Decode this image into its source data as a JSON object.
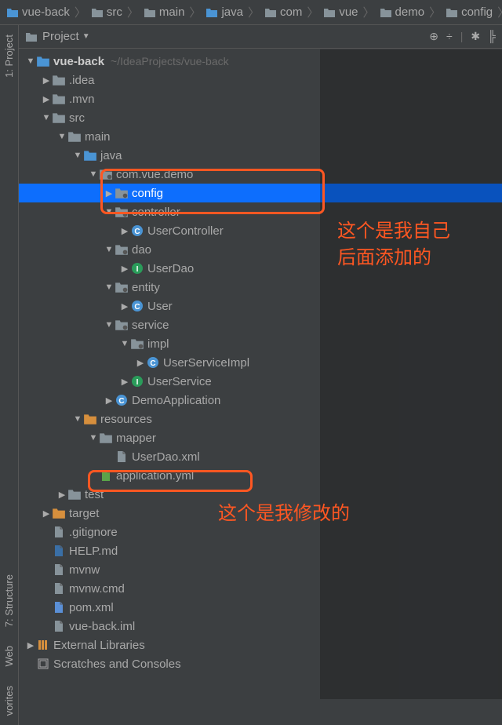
{
  "breadcrumbs": [
    {
      "icon": "folder-blue",
      "label": "vue-back"
    },
    {
      "icon": "folder",
      "label": "src"
    },
    {
      "icon": "folder",
      "label": "main"
    },
    {
      "icon": "folder-blue",
      "label": "java"
    },
    {
      "icon": "folder",
      "label": "com"
    },
    {
      "icon": "folder",
      "label": "vue"
    },
    {
      "icon": "folder",
      "label": "demo"
    },
    {
      "icon": "folder",
      "label": "config"
    }
  ],
  "panel": {
    "title": "Project"
  },
  "sidebarTabs": {
    "project": "1: Project",
    "structure": "7: Structure",
    "web": "Web",
    "favorites": "vorites"
  },
  "tree": {
    "root": {
      "label": "vue-back",
      "path": "~/IdeaProjects/vue-back"
    },
    "nodes": {
      "idea": ".idea",
      "mvn": ".mvn",
      "src": "src",
      "main": "main",
      "java": "java",
      "pkg": "com.vue.demo",
      "config": "config",
      "controller": "controller",
      "userController": "UserController",
      "dao": "dao",
      "userDao": "UserDao",
      "entity": "entity",
      "user": "User",
      "service": "service",
      "impl": "impl",
      "userServiceImpl": "UserServiceImpl",
      "userService": "UserService",
      "demoApp": "DemoApplication",
      "resources": "resources",
      "mapper": "mapper",
      "userDaoXml": "UserDao.xml",
      "appYml": "application.yml",
      "test": "test",
      "target": "target",
      "gitignore": ".gitignore",
      "help": "HELP.md",
      "mvnw": "mvnw",
      "mvnwCmd": "mvnw.cmd",
      "pom": "pom.xml",
      "iml": "vue-back.iml",
      "extLibs": "External Libraries",
      "scratches": "Scratches and Consoles"
    }
  },
  "annotations": {
    "text1": "这个是我自己\n后面添加的",
    "text2": "这个是我修改的"
  }
}
